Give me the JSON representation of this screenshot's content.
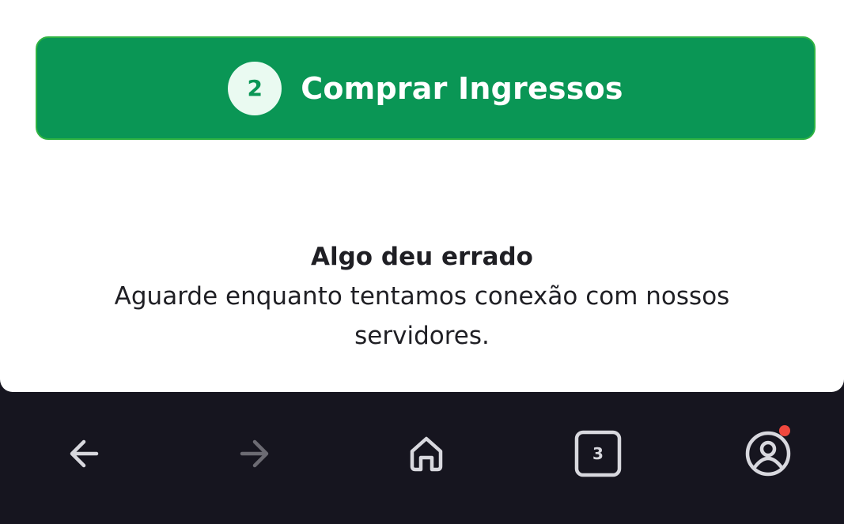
{
  "purchase_step": {
    "number": "2",
    "label": "Comprar Ingressos"
  },
  "error": {
    "title": "Algo deu errado",
    "message": "Aguarde enquanto tentamos conexão com nossos servidores."
  },
  "browser_nav": {
    "back_icon": "arrow-left-icon",
    "forward_icon": "arrow-right-icon",
    "home_icon": "home-icon",
    "tabs_icon": "tabs-icon",
    "tab_count": "3",
    "profile_icon": "profile-icon",
    "notification_color": "#f0483e"
  },
  "colors": {
    "accent_green": "#0a9655",
    "nav_background": "#16151f"
  }
}
